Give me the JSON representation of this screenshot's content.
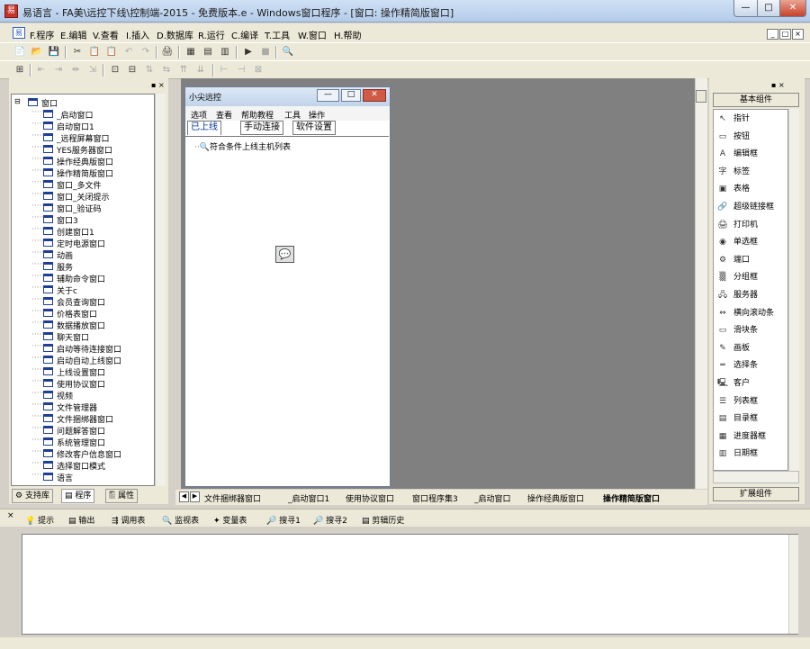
{
  "window": {
    "title": "易语言 - FA美\\远控下线\\控制端-2015 - 免费版本.e - Windows窗口程序 - [窗口: 操作精简版窗口]",
    "minimize": "—",
    "maximize": "□",
    "close": "✕"
  },
  "menubar": {
    "items": [
      "F.程序",
      "E.编辑",
      "V.查看",
      "I.插入",
      "D.数据库",
      "R.运行",
      "C.编译",
      "T.工具",
      "W.窗口",
      "H.帮助"
    ],
    "right_buttons": [
      "_",
      "□",
      "×"
    ]
  },
  "toolbar1": [
    "📄",
    "📂",
    "💾",
    "✂",
    "📋",
    "📋",
    "↶",
    "↷",
    "🖨",
    "▦",
    "▤",
    "▥",
    "▶",
    "■",
    "🔍"
  ],
  "toolbar2": [
    "⊞",
    "⇤",
    "⇥",
    "⇹",
    "⇲",
    "⊡",
    "⊟",
    "⇅",
    "⇆",
    "⇈",
    "⇊",
    "⊢",
    "⊣",
    "⊠"
  ],
  "tree": {
    "root": "窗口",
    "items": [
      "_启动窗口",
      "启动窗口1",
      "_远程屏幕窗口",
      "YES服务器窗口",
      "操作经典版窗口",
      "操作精简版窗口",
      "窗口_多文件",
      "窗口_关闭提示",
      "窗口_验证码",
      "窗口3",
      "创建窗口1",
      "定时电源窗口",
      "动画",
      "服务",
      "辅助命令窗口",
      "关于c",
      "会员查询窗口",
      "价格表窗口",
      "数据播放窗口",
      "聊天窗口",
      "启动等待连接窗口",
      "启动自动上线窗口",
      "上线设置窗口",
      "使用协议窗口",
      "视频",
      "文件管理器",
      "文件捆绑器窗口",
      "问题解答窗口",
      "系统管理窗口",
      "修改客户信息窗口",
      "选择窗口模式",
      "语言"
    ]
  },
  "left_tabs": [
    "支持库",
    "程序",
    "属性"
  ],
  "form": {
    "title": "小尖远控",
    "menu": [
      "选项",
      "查看",
      "帮助教程",
      "工具",
      "操作"
    ],
    "tabs": [
      "已上线",
      "手动连接",
      "软件设置"
    ],
    "tree_item": "符合条件上线主机列表"
  },
  "bottom_tabs": [
    "文件捆绑器窗口",
    "_启动窗口1",
    "使用协议窗口",
    "窗口程序集3",
    "_启动窗口",
    "操作经典版窗口",
    "操作精简版窗口"
  ],
  "right_panel": {
    "top_label": "基本组件",
    "bottom_label": "扩展组件",
    "items": [
      {
        "icon": "↖",
        "label": "指针"
      },
      {
        "icon": "▭",
        "label": "按钮"
      },
      {
        "icon": "A",
        "label": "编辑框"
      },
      {
        "icon": "字",
        "label": "标签"
      },
      {
        "icon": "▣",
        "label": "表格"
      },
      {
        "icon": "🔗",
        "label": "超级链接框"
      },
      {
        "icon": "🖨",
        "label": "打印机"
      },
      {
        "icon": "◉",
        "label": "单选框"
      },
      {
        "icon": "⚙",
        "label": "端口"
      },
      {
        "icon": "▒",
        "label": "分组框"
      },
      {
        "icon": "🖧",
        "label": "服务器"
      },
      {
        "icon": "⇔",
        "label": "横向滚动条"
      },
      {
        "icon": "▭",
        "label": "滑块条"
      },
      {
        "icon": "✎",
        "label": "画板"
      },
      {
        "icon": "═",
        "label": "选择条"
      },
      {
        "icon": "🖳",
        "label": "客户"
      },
      {
        "icon": "☰",
        "label": "列表框"
      },
      {
        "icon": "▤",
        "label": "目录框"
      },
      {
        "icon": "▦",
        "label": "进度器框"
      },
      {
        "icon": "▥",
        "label": "日期框"
      }
    ]
  },
  "output_tabs": [
    "提示",
    "输出",
    "调用表",
    "监视表",
    "变量表",
    "搜寻1",
    "搜寻2",
    "剪辑历史"
  ]
}
